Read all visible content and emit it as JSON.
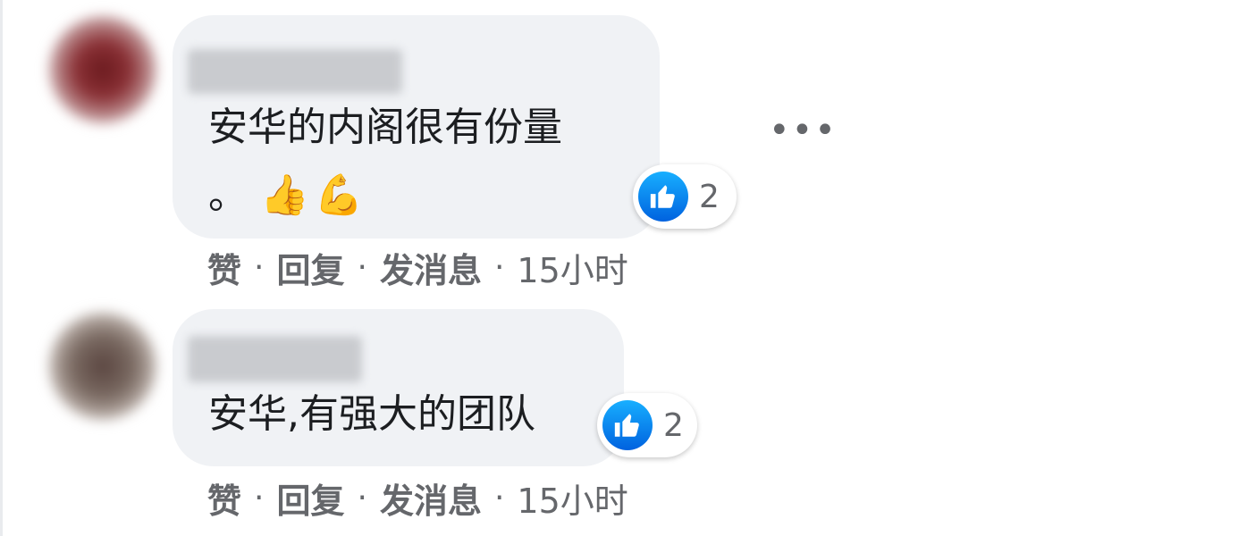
{
  "comments": [
    {
      "text": "安华的内阁很有份量",
      "text_line2": "。",
      "emojis": [
        "👍",
        "💪"
      ],
      "reaction_count": "2",
      "actions": {
        "like": "赞",
        "reply": "回复",
        "message": "发消息",
        "time": "15小时"
      }
    },
    {
      "text": "安华,有强大的团队",
      "reaction_count": "2",
      "actions": {
        "like": "赞",
        "reply": "回复",
        "message": "发消息",
        "time": "15小时"
      }
    }
  ],
  "separator": "·",
  "more_menu": "•••",
  "colors": {
    "bubble_bg": "#f0f2f5",
    "meta_text": "#65676b",
    "like_blue": "#1877f2"
  },
  "icons": {
    "reaction": "like-thumb-icon",
    "more": "more-options-icon"
  }
}
